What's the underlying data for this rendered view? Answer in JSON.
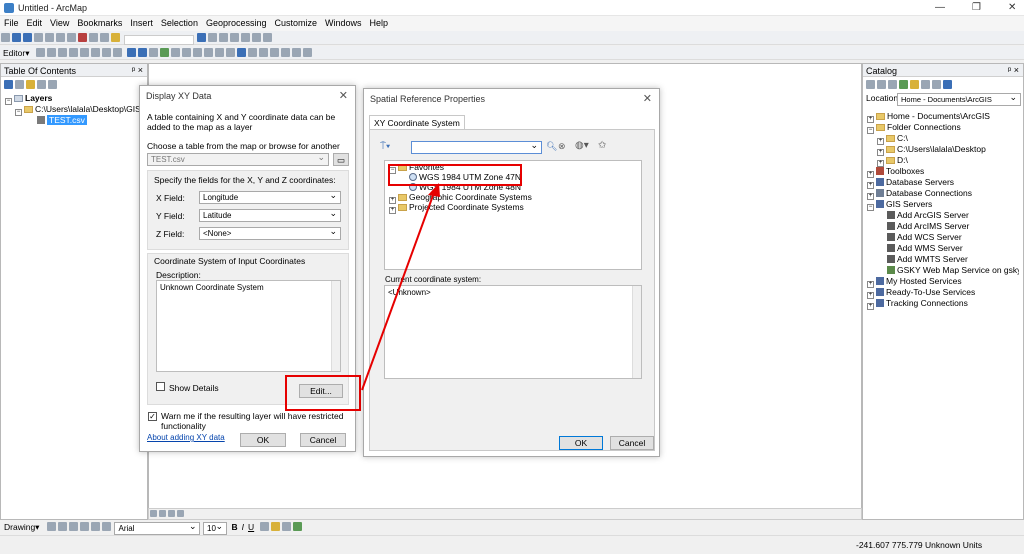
{
  "app": {
    "title": "Untitled - ArcMap"
  },
  "menu": [
    "File",
    "Edit",
    "View",
    "Bookmarks",
    "Insert",
    "Selection",
    "Geoprocessing",
    "Customize",
    "Windows",
    "Help"
  ],
  "toolbar": {
    "editor_label": "Editor▾"
  },
  "toc": {
    "title": "Table Of Contents",
    "layers_label": "Layers",
    "folder_path": "C:\\Users\\lalala\\Desktop\\GIS",
    "table_name": "TEST.csv"
  },
  "display_xy": {
    "title": "Display XY Data",
    "intro": "A table containing X and Y coordinate data can be added to the map as a layer",
    "choose_label": "Choose a table from the map or browse for another table:",
    "table_value": "TEST.csv",
    "fields_label": "Specify the fields for the X, Y and Z coordinates:",
    "x_label": "X Field:",
    "x_value": "Longitude",
    "y_label": "Y Field:",
    "y_value": "Latitude",
    "z_label": "Z Field:",
    "z_value": "<None>",
    "cs_label": "Coordinate System of Input Coordinates",
    "desc_label": "Description:",
    "desc_value": "Unknown Coordinate System",
    "show_details": "Show Details",
    "edit_button": "Edit...",
    "warn_text": "Warn me if the resulting layer will have restricted functionality",
    "about_link": "About adding XY data",
    "ok": "OK",
    "cancel": "Cancel"
  },
  "spatial_ref": {
    "title": "Spatial Reference Properties",
    "tab": "XY Coordinate System",
    "tree": {
      "favorites": "Favorites",
      "fav1": "WGS 1984 UTM Zone 47N",
      "fav2": "WGS 1984 UTM Zone 48N",
      "geo": "Geographic Coordinate Systems",
      "proj": "Projected Coordinate Systems"
    },
    "current_label": "Current coordinate system:",
    "current_value": "<Unknown>",
    "ok": "OK",
    "cancel": "Cancel"
  },
  "catalog": {
    "title": "Catalog",
    "location_label": "Location:",
    "location_value": "Home - Documents\\ArcGIS",
    "items": {
      "home": "Home - Documents\\ArcGIS",
      "folder_conn": "Folder Connections",
      "c": "C:\\",
      "desktop": "C:\\Users\\lalala\\Desktop",
      "d": "D:\\",
      "toolboxes": "Toolboxes",
      "db_servers": "Database Servers",
      "db_conn": "Database Connections",
      "gis_servers": "GIS Servers",
      "add_arcgis": "Add ArcGIS Server",
      "add_arcims": "Add ArcIMS Server",
      "add_wcs": "Add WCS Server",
      "add_wms": "Add WMS Server",
      "add_wmts": "Add WMTS Server",
      "gsky": "GSKY Web Map Service on gsky.nci",
      "hosted": "My Hosted Services",
      "ready": "Ready-To-Use Services",
      "tracking": "Tracking Connections"
    }
  },
  "drawing": {
    "label": "Drawing▾",
    "font": "Arial",
    "size": "10",
    "b": "B",
    "i": "I",
    "u": "U"
  },
  "status": {
    "coords": "-241.607  775.779 Unknown Units"
  }
}
